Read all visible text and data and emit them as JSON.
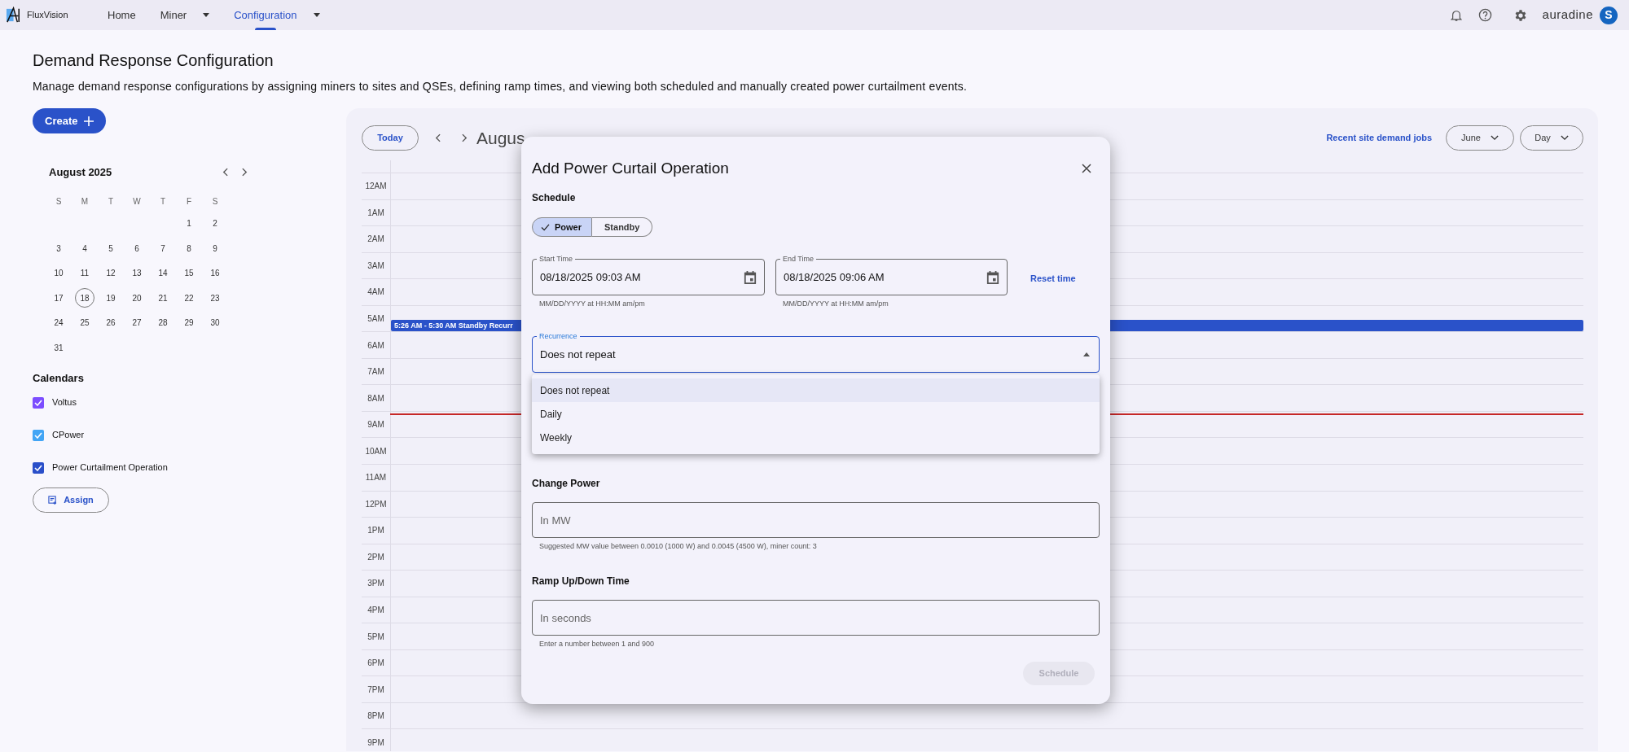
{
  "nav": {
    "brand": "FluxVision",
    "items": [
      {
        "label": "Home",
        "selected": false,
        "has_menu": false
      },
      {
        "label": "Miner",
        "selected": false,
        "has_menu": true
      },
      {
        "label": "Configuration",
        "selected": true,
        "has_menu": true
      }
    ],
    "org": "auradine",
    "avatar": "S"
  },
  "page": {
    "title": "Demand Response Configuration",
    "description": "Manage demand response configurations by assigning miners to sites and QSEs, defining ramp times, and viewing both scheduled and manually created power curtailment events.",
    "create_button": "Create"
  },
  "mini_calendar": {
    "month": "August 2025",
    "weekdays": [
      "S",
      "M",
      "T",
      "W",
      "T",
      "F",
      "S"
    ],
    "weeks": [
      [
        {
          "label": "1",
          "selected": false
        },
        {
          "label": "2",
          "selected": false
        }
      ],
      [
        {
          "label": "3",
          "selected": false
        },
        {
          "label": "4",
          "selected": false
        },
        {
          "label": "5",
          "selected": false
        },
        {
          "label": "6",
          "selected": false
        },
        {
          "label": "7",
          "selected": false
        },
        {
          "label": "8",
          "selected": false
        },
        {
          "label": "9",
          "selected": false
        }
      ],
      [
        {
          "label": "10",
          "selected": false
        },
        {
          "label": "11",
          "selected": false
        },
        {
          "label": "12",
          "selected": false
        },
        {
          "label": "13",
          "selected": false
        },
        {
          "label": "14",
          "selected": false
        },
        {
          "label": "15",
          "selected": false
        },
        {
          "label": "16",
          "selected": false
        }
      ],
      [
        {
          "label": "17",
          "selected": false
        },
        {
          "label": "18",
          "selected": true
        },
        {
          "label": "19",
          "selected": false
        },
        {
          "label": "20",
          "selected": false
        },
        {
          "label": "21",
          "selected": false
        },
        {
          "label": "22",
          "selected": false
        },
        {
          "label": "23",
          "selected": false
        }
      ],
      [
        {
          "label": "24",
          "selected": false
        },
        {
          "label": "25",
          "selected": false
        },
        {
          "label": "26",
          "selected": false
        },
        {
          "label": "27",
          "selected": false
        },
        {
          "label": "28",
          "selected": false
        },
        {
          "label": "29",
          "selected": false
        },
        {
          "label": "30",
          "selected": false
        }
      ],
      [
        {
          "label": "31",
          "selected": false
        }
      ]
    ]
  },
  "calendars": {
    "title": "Calendars",
    "items": [
      {
        "label": "Voltus",
        "checked": true,
        "color": "#7c4dff"
      },
      {
        "label": "CPower",
        "checked": true,
        "color": "#42a5f5"
      },
      {
        "label": "Power Curtailment Operation",
        "checked": true,
        "color": "#2a4fc9"
      }
    ],
    "assign_button": "Assign"
  },
  "calendar": {
    "today_button": "Today",
    "date_title": "Augus",
    "recent_jobs_link": "Recent site demand jobs",
    "month_select": "June",
    "view_select": "Day",
    "hours": [
      {
        "label": "12AM"
      },
      {
        "label": "1AM"
      },
      {
        "label": "2AM"
      },
      {
        "label": "3AM"
      },
      {
        "label": "4AM"
      },
      {
        "label": "5AM",
        "events": [
          {
            "label": "5:26 AM - 5:30 AM Standby Recurr"
          }
        ]
      },
      {
        "label": "6AM"
      },
      {
        "label": "7AM"
      },
      {
        "label": "8AM"
      },
      {
        "label": "9AM",
        "now_line": true
      },
      {
        "label": "10AM"
      },
      {
        "label": "11AM"
      },
      {
        "label": "12PM"
      },
      {
        "label": "1PM"
      },
      {
        "label": "2PM"
      },
      {
        "label": "3PM"
      },
      {
        "label": "4PM"
      },
      {
        "label": "5PM"
      },
      {
        "label": "6PM"
      },
      {
        "label": "7PM"
      },
      {
        "label": "8PM"
      },
      {
        "label": "9PM"
      }
    ]
  },
  "dialog": {
    "title": "Add Power Curtail Operation",
    "schedule_label": "Schedule",
    "schedule_options": [
      {
        "label": "Power",
        "selected": true
      },
      {
        "label": "Standby",
        "selected": false
      }
    ],
    "start_time": {
      "label": "Start Time",
      "value": "08/18/2025 09:03 AM",
      "helper": "MM/DD/YYYY at HH:MM am/pm"
    },
    "end_time": {
      "label": "End Time",
      "value": "08/18/2025 09:06 AM",
      "helper": "MM/DD/YYYY at HH:MM am/pm"
    },
    "reset_button": "Reset time",
    "recurrence": {
      "label": "Recurrence",
      "value": "Does not repeat",
      "expanded": true,
      "options": [
        {
          "label": "Does not repeat",
          "selected": true
        },
        {
          "label": "Daily",
          "selected": false
        },
        {
          "label": "Weekly",
          "selected": false
        }
      ]
    },
    "change_power": {
      "label": "Change Power",
      "placeholder": "In MW",
      "helper": "Suggested MW value between 0.0010 (1000 W) and 0.0045 (4500 W), miner count: 3"
    },
    "ramp": {
      "label": "Ramp Up/Down Time",
      "placeholder": "In seconds",
      "helper": "Enter a number between 1 and 900"
    },
    "schedule_button": {
      "label": "Schedule",
      "disabled": true
    }
  }
}
